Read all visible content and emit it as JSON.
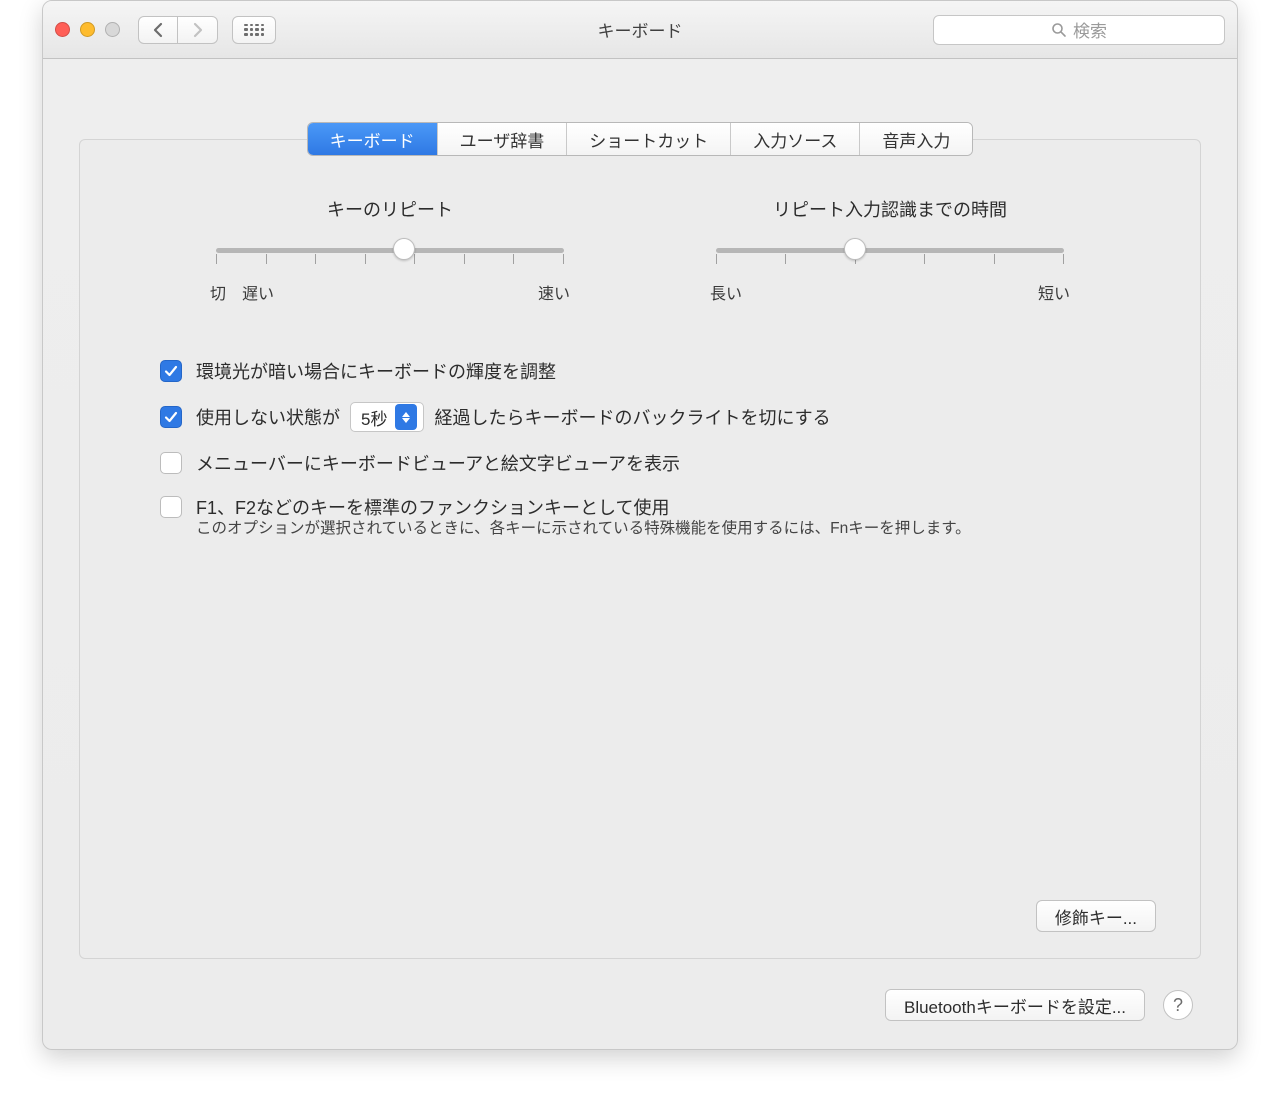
{
  "window": {
    "title": "キーボード"
  },
  "search": {
    "placeholder": "検索"
  },
  "tabs": [
    {
      "label": "キーボード",
      "active": true
    },
    {
      "label": "ユーザ辞書",
      "active": false
    },
    {
      "label": "ショートカット",
      "active": false
    },
    {
      "label": "入力ソース",
      "active": false
    },
    {
      "label": "音声入力",
      "active": false
    }
  ],
  "sliders": {
    "repeat": {
      "title": "キーのリピート",
      "left_label": "切",
      "left_label2": "遅い",
      "right_label": "速い",
      "ticks": 8,
      "position_pct": 54
    },
    "delay": {
      "title": "リピート入力認識までの時間",
      "left_label": "長い",
      "right_label": "短い",
      "ticks": 6,
      "position_pct": 40
    }
  },
  "options": {
    "brightness": {
      "checked": true,
      "label": "環境光が暗い場合にキーボードの輝度を調整"
    },
    "backlight_off": {
      "checked": true,
      "prefix": "使用しない状態が",
      "select_value": "5秒",
      "suffix": "経過したらキーボードのバックライトを切にする"
    },
    "viewer": {
      "checked": false,
      "label": "メニューバーにキーボードビューアと絵文字ビューアを表示"
    },
    "fn_keys": {
      "checked": false,
      "label": "F1、F2などのキーを標準のファンクションキーとして使用",
      "description": "このオプションが選択されているときに、各キーに示されている特殊機能を使用するには、Fnキーを押します。"
    }
  },
  "buttons": {
    "modifier": "修飾キー...",
    "bluetooth": "Bluetoothキーボードを設定...",
    "help": "?"
  }
}
